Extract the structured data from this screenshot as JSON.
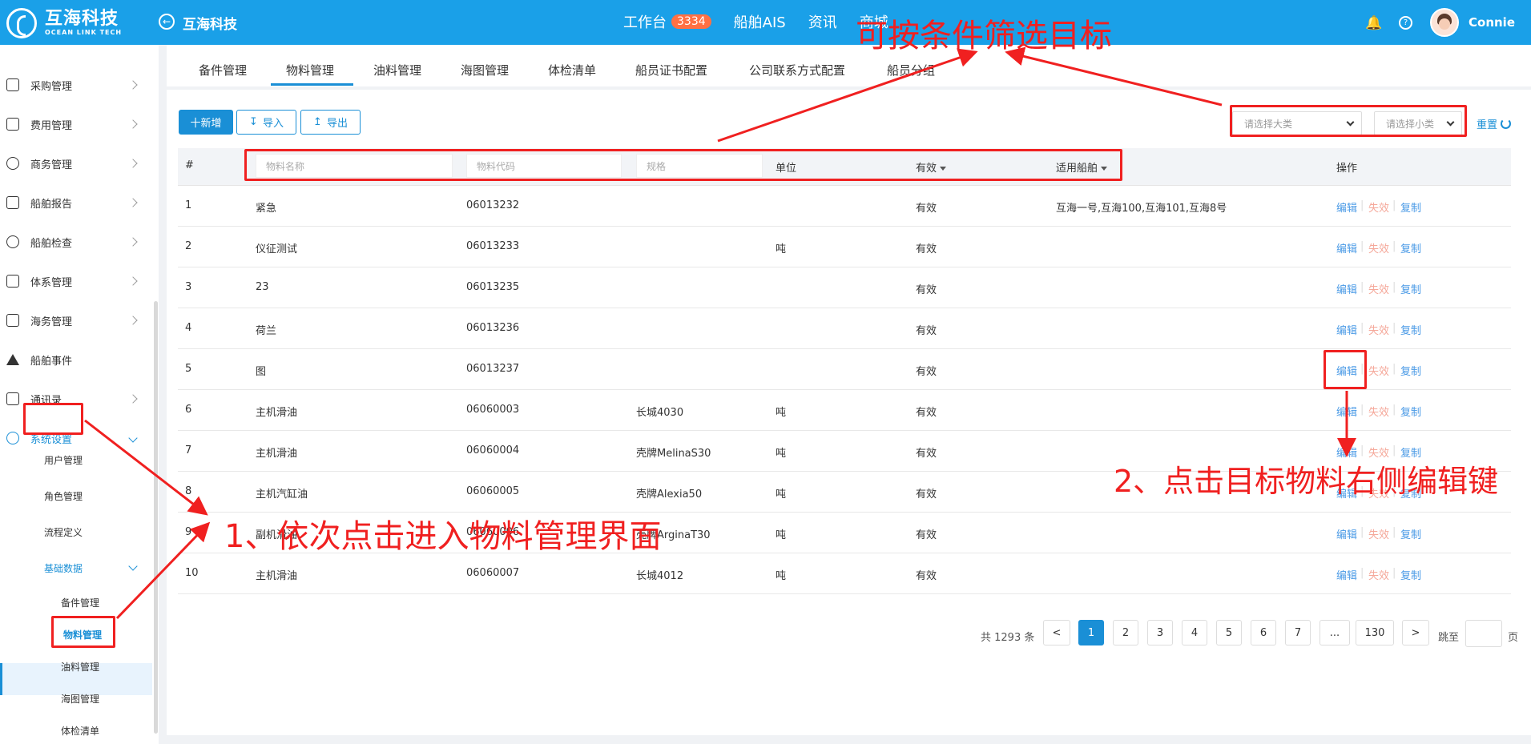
{
  "brand": {
    "name_cn": "互海科技",
    "name_en": "OCEAN LINK TECH",
    "icon": "ocean-link-logo"
  },
  "topbar": {
    "title": "互海科技",
    "nav": [
      {
        "label": "工作台",
        "badge": "3334"
      },
      {
        "label": "船舶AIS"
      },
      {
        "label": "资讯"
      },
      {
        "label": "商城"
      }
    ],
    "icons": [
      "bell-icon",
      "help-icon"
    ],
    "user": "Connie"
  },
  "sidebar": {
    "items": [
      {
        "label": "采购管理",
        "icon": "cart-icon"
      },
      {
        "label": "费用管理",
        "icon": "database-icon"
      },
      {
        "label": "商务管理",
        "icon": "globe-icon"
      },
      {
        "label": "船舶报告",
        "icon": "calendar-icon"
      },
      {
        "label": "船舶检查",
        "icon": "check-circle-icon"
      },
      {
        "label": "体系管理",
        "icon": "document-icon"
      },
      {
        "label": "海务管理",
        "icon": "signpost-icon"
      },
      {
        "label": "船舶事件",
        "icon": "warning-icon"
      },
      {
        "label": "通讯录",
        "icon": "contacts-icon"
      },
      {
        "label": "系统设置",
        "icon": "gear-icon"
      }
    ],
    "subitems": [
      "用户管理",
      "角色管理",
      "流程定义",
      "基础数据"
    ],
    "leafitems": [
      "备件管理",
      "物料管理",
      "油料管理",
      "海图管理",
      "体检清单"
    ]
  },
  "tabs": [
    "备件管理",
    "物料管理",
    "油料管理",
    "海图管理",
    "体检清单",
    "船员证书配置",
    "公司联系方式配置",
    "船员分组"
  ],
  "toolbar": {
    "add": "十新增",
    "import": "导入",
    "export": "导出",
    "reset": "重置"
  },
  "filters": {
    "major_placeholder": "请选择大类",
    "minor_placeholder": "请选择小类"
  },
  "table": {
    "headers": {
      "index": "#",
      "name_placeholder": "物料名称",
      "code_placeholder": "物料代码",
      "spec_placeholder": "规格",
      "unit": "单位",
      "valid": "有效",
      "vessel": "适用船舶",
      "actions": "操作"
    },
    "rows": [
      {
        "no": "1",
        "name": "紧急",
        "code": "06013232",
        "spec": "",
        "unit": "",
        "valid": "有效",
        "vessel": "互海一号,互海100,互海101,互海8号"
      },
      {
        "no": "2",
        "name": "仪征测试",
        "code": "06013233",
        "spec": "",
        "unit": "吨",
        "valid": "有效",
        "vessel": ""
      },
      {
        "no": "3",
        "name": "23",
        "code": "06013235",
        "spec": "",
        "unit": "",
        "valid": "有效",
        "vessel": ""
      },
      {
        "no": "4",
        "name": "荷兰",
        "code": "06013236",
        "spec": "",
        "unit": "",
        "valid": "有效",
        "vessel": ""
      },
      {
        "no": "5",
        "name": "图",
        "code": "06013237",
        "spec": "",
        "unit": "",
        "valid": "有效",
        "vessel": ""
      },
      {
        "no": "6",
        "name": "主机滑油",
        "code": "06060003",
        "spec": "长城4030",
        "unit": "吨",
        "valid": "有效",
        "vessel": ""
      },
      {
        "no": "7",
        "name": "主机滑油",
        "code": "06060004",
        "spec": "壳牌MelinaS30",
        "unit": "吨",
        "valid": "有效",
        "vessel": ""
      },
      {
        "no": "8",
        "name": "主机汽缸油",
        "code": "06060005",
        "spec": "壳牌Alexia50",
        "unit": "吨",
        "valid": "有效",
        "vessel": ""
      },
      {
        "no": "9",
        "name": "副机滑油",
        "code": "06060006",
        "spec": "壳牌ArginaT30",
        "unit": "吨",
        "valid": "有效",
        "vessel": ""
      },
      {
        "no": "10",
        "name": "主机滑油",
        "code": "06060007",
        "spec": "长城4012",
        "unit": "吨",
        "valid": "有效",
        "vessel": ""
      }
    ],
    "actions": {
      "edit": "编辑",
      "void": "失效",
      "copy": "复制",
      "sep": "|"
    }
  },
  "pagination": {
    "total": "共 1293 条",
    "prev": "<",
    "next": ">",
    "pages": [
      "1",
      "2",
      "3",
      "4",
      "5",
      "6",
      "7",
      "...",
      "130"
    ],
    "current": "1",
    "jump_label": "跳至",
    "jump_suffix": "页"
  },
  "annotations": {
    "filter_note": "可按条件筛选目标",
    "step1": "1、依次点击进入物料管理界面",
    "step2": "2、点击目标物料右侧编辑键"
  },
  "colors": {
    "header": "#1aa0e8",
    "accent": "#1a8fd6",
    "annotation": "#f02020",
    "void": "#f5a89a",
    "badge": "#ff7043"
  }
}
